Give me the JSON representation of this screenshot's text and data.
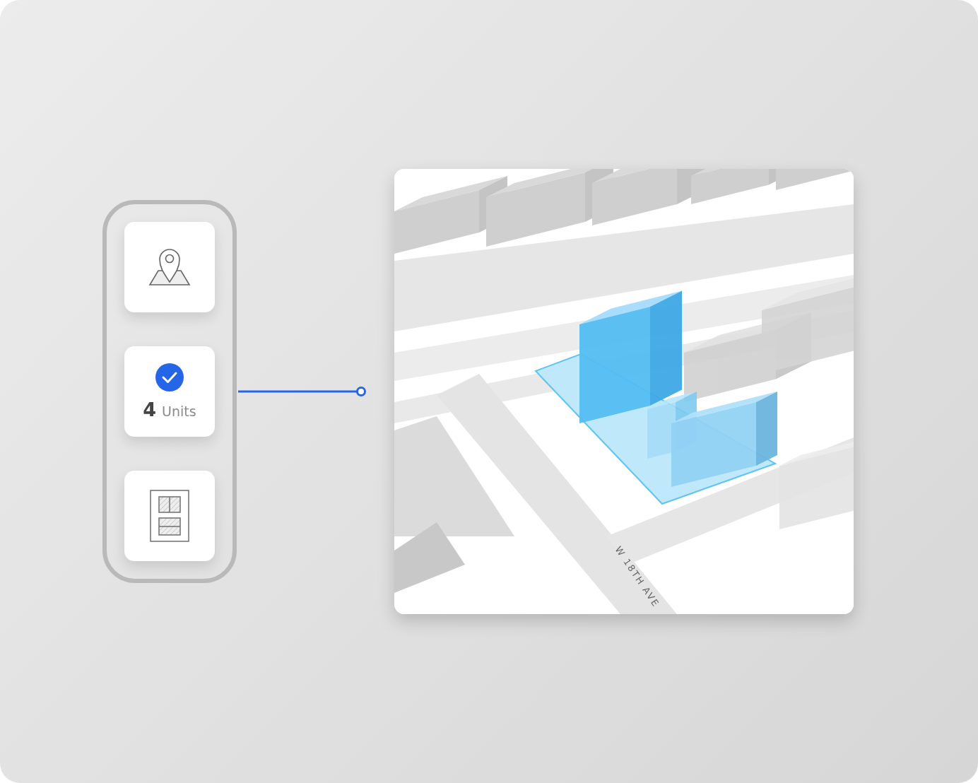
{
  "option_cards": [
    {
      "kind": "location"
    },
    {
      "kind": "units",
      "checked": true,
      "count": "4",
      "label": "Units"
    },
    {
      "kind": "floorplan"
    }
  ],
  "map": {
    "street_label": "W 18TH AVE"
  }
}
